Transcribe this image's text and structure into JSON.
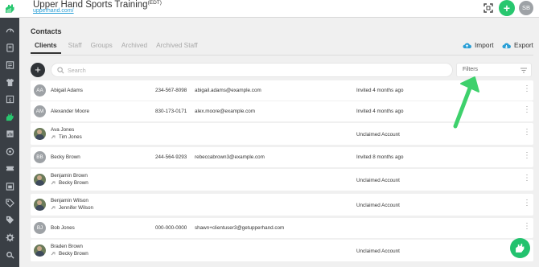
{
  "app": {
    "title": "Upper Hand Sports Training",
    "title_suffix": "(EDT)",
    "url": "upperhand.com/",
    "user_initials": "SB",
    "create_button_icon": "plus-icon",
    "expand_icon": "fullscreen-icon"
  },
  "sidebar": {
    "logo_icon": "upper-hand-logo",
    "items": [
      {
        "icon": "dashboard-gauge-icon"
      },
      {
        "icon": "book-icon"
      },
      {
        "icon": "calendar-list-icon"
      },
      {
        "icon": "shirt-icon"
      },
      {
        "icon": "dollar-icon"
      },
      {
        "icon": "contacts-hand-icon",
        "active": true
      },
      {
        "icon": "reports-icon"
      },
      {
        "icon": "refresh-circle-icon"
      },
      {
        "icon": "ticket-icon"
      },
      {
        "icon": "calendar-icon"
      },
      {
        "icon": "tag-icon"
      },
      {
        "icon": "tags-icon"
      },
      {
        "icon": "settings-gear-icon"
      },
      {
        "icon": "gear-user-icon"
      }
    ]
  },
  "page": {
    "title": "Contacts",
    "tabs": [
      {
        "label": "Clients",
        "active": true
      },
      {
        "label": "Staff"
      },
      {
        "label": "Groups"
      },
      {
        "label": "Archived"
      },
      {
        "label": "Archived Staff"
      }
    ],
    "import_label": "Import",
    "export_label": "Export",
    "search_placeholder": "Search",
    "filters_label": "Filters"
  },
  "clients": [
    {
      "initials": "AA",
      "name": "Abigail Adams",
      "phone": "234-567-8098",
      "email": "abigail.adams@example.com",
      "status": "Invited 4 months ago",
      "managed_by": "",
      "photo": false
    },
    {
      "initials": "AM",
      "name": "Alexander Moore",
      "phone": "830-173-0171",
      "email": "alex.moore@example.com",
      "status": "Invited 4 months ago",
      "managed_by": "",
      "photo": false
    },
    {
      "initials": "",
      "name": "Ava Jones",
      "phone": "",
      "email": "",
      "status": "Unclaimed Account",
      "managed_by": "Tim Jones",
      "photo": true
    },
    {
      "initials": "BB",
      "name": "Becky Brown",
      "phone": "244-564-9293",
      "email": "rebeccabrown3@example.com",
      "status": "Invited 8 months ago",
      "managed_by": "",
      "photo": false
    },
    {
      "initials": "",
      "name": "Benjamin Brown",
      "phone": "",
      "email": "",
      "status": "Unclaimed Account",
      "managed_by": "Becky Brown",
      "photo": true
    },
    {
      "initials": "",
      "name": "Benjamin Wilson",
      "phone": "",
      "email": "",
      "status": "Unclaimed Account",
      "managed_by": "Jennifer Wilson",
      "photo": true
    },
    {
      "initials": "BJ",
      "name": "Bob Jones",
      "phone": "000-000-0000",
      "email": "shawn+clientuser3@getupperhand.com",
      "status": "",
      "managed_by": "",
      "photo": false
    },
    {
      "initials": "",
      "name": "Braden Brown",
      "phone": "",
      "email": "",
      "status": "Unclaimed Account",
      "managed_by": "Becky Brown",
      "photo": true
    }
  ],
  "colors": {
    "brand_green": "#28c76f",
    "sidebar_bg": "#3a3f45",
    "link_blue": "#2a9fd6",
    "annotation_arrow": "#3ed16c"
  },
  "overlays": {
    "annotation": "green-arrow-pointing-to-filters",
    "chat_icon": "chat-support-icon"
  }
}
